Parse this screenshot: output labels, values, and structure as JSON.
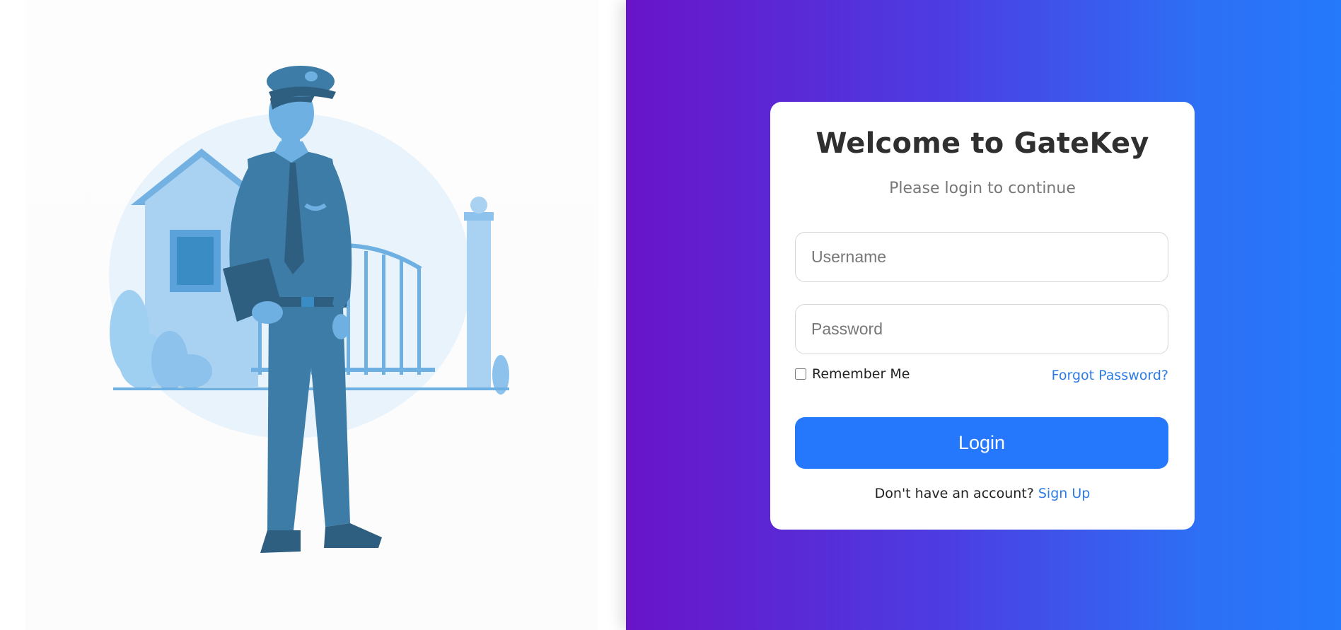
{
  "login": {
    "title": "Welcome to GateKey",
    "subtitle": "Please login to continue",
    "username_placeholder": "Username",
    "password_placeholder": "Password",
    "remember_label": "Remember Me",
    "forgot_label": "Forgot Password?",
    "login_label": "Login",
    "signup_prompt": "Don't have an account?",
    "signup_label": "Sign Up"
  },
  "colors": {
    "gradient_start": "#6914c9",
    "gradient_end": "#2579fb",
    "accent": "#2577fb",
    "link": "#2c7be5"
  },
  "illustration": {
    "name": "security-guard-illustration"
  }
}
